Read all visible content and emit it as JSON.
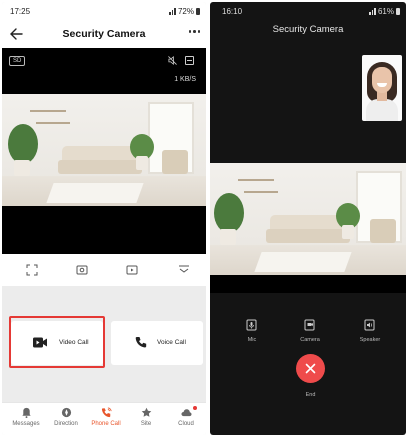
{
  "left": {
    "status": {
      "time": "17:25",
      "battery": "72%"
    },
    "header": {
      "title": "Security Camera"
    },
    "video": {
      "quality_badge": "SD",
      "bitrate": "1 KB/S"
    },
    "calls": {
      "video_call_label": "Video Call",
      "voice_call_label": "Voice Call"
    },
    "tabs": [
      {
        "label": "Messages",
        "icon": "bell-icon"
      },
      {
        "label": "Direction",
        "icon": "compass-icon"
      },
      {
        "label": "Phone Call",
        "icon": "phone-call-icon",
        "active": true
      },
      {
        "label": "Site",
        "icon": "star-icon"
      },
      {
        "label": "Cloud",
        "icon": "cloud-icon"
      }
    ],
    "accent": "#e8552b",
    "highlight_color": "#e53935"
  },
  "right": {
    "status": {
      "time": "16:10",
      "battery": "61%"
    },
    "title": "Security Camera",
    "controls": [
      {
        "label": "Mic",
        "icon": "mic-icon"
      },
      {
        "label": "Camera",
        "icon": "camera-icon"
      },
      {
        "label": "Speaker",
        "icon": "speaker-icon"
      }
    ],
    "end_label": "End",
    "end_color": "#ef4b4b"
  }
}
